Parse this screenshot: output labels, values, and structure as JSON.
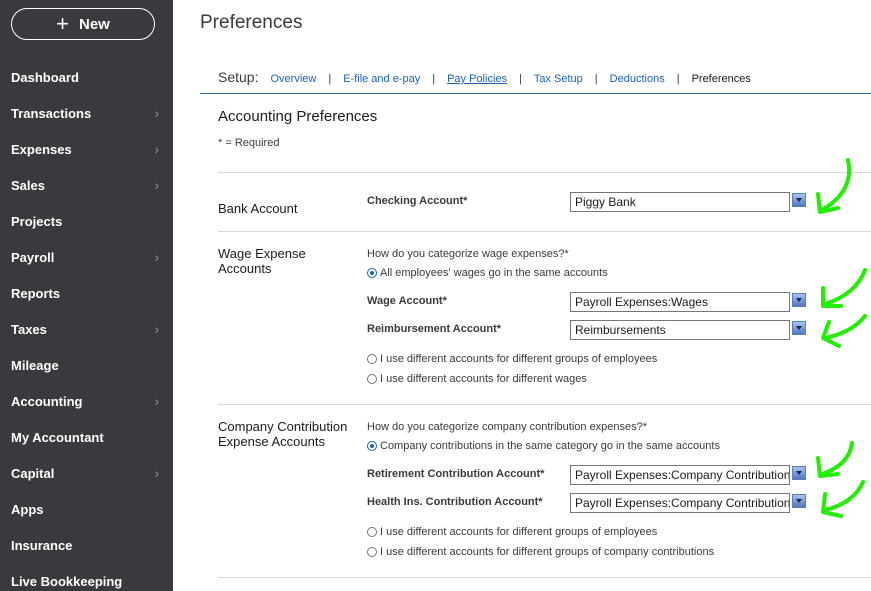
{
  "sidebar": {
    "new_button": "New",
    "items": [
      {
        "label": "Dashboard",
        "chevron": false
      },
      {
        "label": "Transactions",
        "chevron": true
      },
      {
        "label": "Expenses",
        "chevron": true
      },
      {
        "label": "Sales",
        "chevron": true
      },
      {
        "label": "Projects",
        "chevron": false
      },
      {
        "label": "Payroll",
        "chevron": true
      },
      {
        "label": "Reports",
        "chevron": false
      },
      {
        "label": "Taxes",
        "chevron": true
      },
      {
        "label": "Mileage",
        "chevron": false
      },
      {
        "label": "Accounting",
        "chevron": true
      },
      {
        "label": "My Accountant",
        "chevron": false
      },
      {
        "label": "Capital",
        "chevron": true
      },
      {
        "label": "Apps",
        "chevron": false
      },
      {
        "label": "Insurance",
        "chevron": false
      },
      {
        "label": "Live Bookkeeping",
        "chevron": false
      }
    ]
  },
  "page": {
    "title": "Preferences"
  },
  "setup": {
    "label": "Setup:",
    "links": [
      "Overview",
      "E-file and e-pay",
      "Pay Policies",
      "Tax Setup",
      "Deductions"
    ],
    "separator": "|",
    "current": "Preferences"
  },
  "accounting": {
    "title": "Accounting Preferences",
    "required_note": "* = Required",
    "bank": {
      "label": "Bank Account",
      "field_label": "Checking Account*",
      "value": "Piggy Bank"
    },
    "wage": {
      "label_line1": "Wage Expense",
      "label_line2": "Accounts",
      "question": "How do you categorize wage expenses?*",
      "option_same": "All employees' wages go in the same accounts",
      "wage_account_label": "Wage Account*",
      "wage_account_value": "Payroll Expenses:Wages",
      "reimb_label": "Reimbursement Account*",
      "reimb_value": "Reimbursements",
      "option_groups": "I use different accounts for different groups of employees",
      "option_wages": "I use different accounts for different wages"
    },
    "company": {
      "label_line1": "Company Contribution",
      "label_line2": "Expense Accounts",
      "question": "How do you categorize company contribution expenses?*",
      "option_same": "Company contributions in the same category go in the same accounts",
      "retirement_label": "Retirement Contribution Account*",
      "retirement_value": "Payroll Expenses:Company Contributions",
      "health_label": "Health Ins. Contribution Account*",
      "health_value": "Payroll Expenses:Company Contributions",
      "option_groups": "I use different accounts for different groups of employees",
      "option_contrib": "I use different accounts for different groups of company contributions"
    }
  },
  "colors": {
    "sidebar_bg": "#393a3d",
    "link": "#1a62b2",
    "annotation_arrow": "#22ee00"
  }
}
